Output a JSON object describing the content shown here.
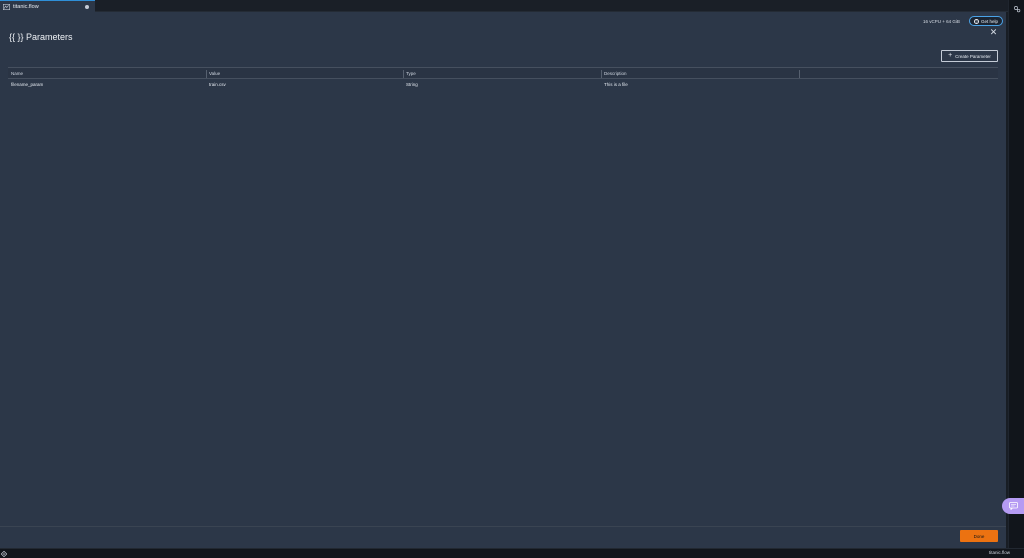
{
  "tabs": [
    {
      "label": "titanic.flow",
      "active": true,
      "unsaved": true
    }
  ],
  "header": {
    "resource": "16 vCPU + 64 GiB",
    "help_label": "Get help",
    "title": "{{ }} Parameters"
  },
  "toolbar": {
    "create_label": "Create Parameter"
  },
  "table": {
    "columns": [
      "Name",
      "Value",
      "Type",
      "Description"
    ],
    "rows": [
      {
        "name": "filename_param",
        "value": "train.csv",
        "type": "String",
        "description": "This is a file"
      }
    ]
  },
  "footer": {
    "done_label": "Done"
  },
  "statusbar": {
    "label": "titanic.flow"
  },
  "colors": {
    "accent": "#ec7211",
    "panel": "#2c3748",
    "help_border": "#4aa3e8",
    "chat": "#b59bf3"
  },
  "icons": {
    "tab": "flow-icon",
    "help": "question-circle-icon",
    "close": "close-icon",
    "create": "plus-icon",
    "settings": "gear-icon",
    "chat": "chat-icon",
    "status": "diamond-icon"
  }
}
